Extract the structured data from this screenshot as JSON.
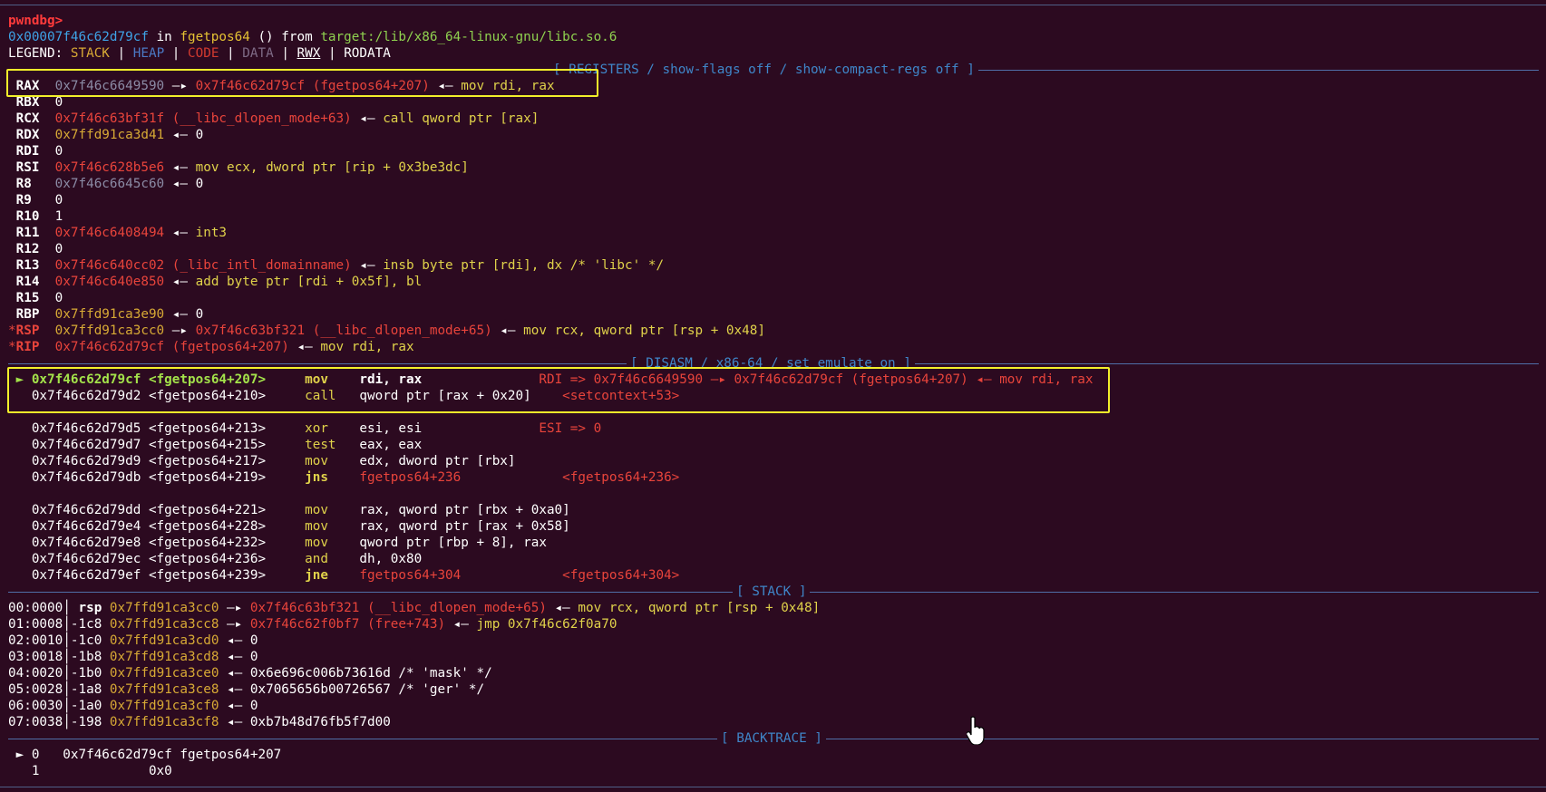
{
  "prompt": "pwndbg>",
  "location": {
    "addr": "0x00007f46c62d79cf",
    "in": " in ",
    "func": "fgetpos64",
    "args": " () from ",
    "lib": "target:/lib/x86_64-linux-gnu/libc.so.6"
  },
  "legend": {
    "label": "LEGEND: ",
    "stack": "STACK",
    "heap": "HEAP",
    "code": "CODE",
    "data": "DATA",
    "rwx": "RWX",
    "rodata": "RODATA",
    "sep": " | "
  },
  "sections": {
    "registers": "[ REGISTERS / show-flags off / show-compact-regs off ]",
    "disasm": "[ DISASM / x86-64 / set emulate on ]",
    "stack": "[ STACK ]",
    "backtrace": "[ BACKTRACE ]"
  },
  "registers": [
    {
      "star": " ",
      "name": "RAX",
      "pad": " ",
      "value": "0x7f46c6649590",
      "arrow1": " —▸ ",
      "target": "0x7f46c62d79cf (fgetpos64+207)",
      "arrow2": " ◂— ",
      "insn": "mov rdi, rax"
    },
    {
      "star": " ",
      "name": "RBX",
      "pad": " ",
      "value": "0"
    },
    {
      "star": " ",
      "name": "RCX",
      "pad": " ",
      "value": "0x7f46c63bf31f (__libc_dlopen_mode+63)",
      "arrow2": " ◂— ",
      "insn": "call qword ptr [rax]"
    },
    {
      "star": " ",
      "name": "RDX",
      "pad": " ",
      "value": "0x7ffd91ca3d41",
      "arrow2": " ◂— ",
      "insn": "0"
    },
    {
      "star": " ",
      "name": "RDI",
      "pad": " ",
      "value": "0"
    },
    {
      "star": " ",
      "name": "RSI",
      "pad": " ",
      "value": "0x7f46c628b5e6",
      "arrow2": " ◂— ",
      "insn": "mov ecx, dword ptr [rip + 0x3be3dc]"
    },
    {
      "star": " ",
      "name": "R8",
      "pad": "  ",
      "value": "0x7f46c6645c60",
      "arrow2": " ◂— ",
      "insn": "0"
    },
    {
      "star": " ",
      "name": "R9",
      "pad": "  ",
      "value": "0"
    },
    {
      "star": " ",
      "name": "R10",
      "pad": " ",
      "value": "1"
    },
    {
      "star": " ",
      "name": "R11",
      "pad": " ",
      "value": "0x7f46c6408494",
      "arrow2": " ◂— ",
      "insn": "int3"
    },
    {
      "star": " ",
      "name": "R12",
      "pad": " ",
      "value": "0"
    },
    {
      "star": " ",
      "name": "R13",
      "pad": " ",
      "value": "0x7f46c640cc02 (_libc_intl_domainname)",
      "arrow2": " ◂— ",
      "insn": "insb byte ptr [rdi], dx /* 'libc' */"
    },
    {
      "star": " ",
      "name": "R14",
      "pad": " ",
      "value": "0x7f46c640e850",
      "arrow2": " ◂— ",
      "insn": "add byte ptr [rdi + 0x5f], bl"
    },
    {
      "star": " ",
      "name": "R15",
      "pad": " ",
      "value": "0"
    },
    {
      "star": " ",
      "name": "RBP",
      "pad": " ",
      "value": "0x7ffd91ca3e90",
      "arrow2": " ◂— ",
      "insn": "0"
    },
    {
      "star": "*",
      "name": "RSP",
      "pad": " ",
      "value": "0x7ffd91ca3cc0",
      "arrow1": " —▸ ",
      "target": "0x7f46c63bf321 (__libc_dlopen_mode+65)",
      "arrow2": " ◂— ",
      "insn": "mov rcx, qword ptr [rsp + 0x48]"
    },
    {
      "star": "*",
      "name": "RIP",
      "pad": " ",
      "value": "0x7f46c62d79cf (fgetpos64+207)",
      "arrow2": " ◂— ",
      "insn": "mov rdi, rax"
    }
  ],
  "disasm": [
    {
      "marker": "► ",
      "addr": "0x7f46c62d79cf",
      "sym": "<fgetpos64+207>",
      "mnem": "mov",
      "ops": "rdi, rax",
      "comment": "RDI => 0x7f46c6649590 —▸ 0x7f46c62d79cf (fgetpos64+207) ◂— mov rdi, rax",
      "current": true
    },
    {
      "marker": "  ",
      "addr": "0x7f46c62d79d2",
      "sym": "<fgetpos64+210>",
      "mnem": "call",
      "ops": "qword ptr [rax + 0x20]",
      "comment": "<setcontext+53>"
    },
    {
      "blank": true
    },
    {
      "marker": "  ",
      "addr": "0x7f46c62d79d5",
      "sym": "<fgetpos64+213>",
      "mnem": "xor",
      "ops": "esi, esi",
      "comment": "ESI => 0"
    },
    {
      "marker": "  ",
      "addr": "0x7f46c62d79d7",
      "sym": "<fgetpos64+215>",
      "mnem": "test",
      "ops": "eax, eax",
      "comment": ""
    },
    {
      "marker": "  ",
      "addr": "0x7f46c62d79d9",
      "sym": "<fgetpos64+217>",
      "mnem": "mov",
      "ops": "edx, dword ptr [rbx]",
      "comment": ""
    },
    {
      "marker": "  ",
      "addr": "0x7f46c62d79db",
      "sym": "<fgetpos64+219>",
      "mnem": "jns",
      "ops": "fgetpos64+236",
      "comment": "<fgetpos64+236>"
    },
    {
      "blank": true
    },
    {
      "marker": "  ",
      "addr": "0x7f46c62d79dd",
      "sym": "<fgetpos64+221>",
      "mnem": "mov",
      "ops": "rax, qword ptr [rbx + 0xa0]",
      "comment": ""
    },
    {
      "marker": "  ",
      "addr": "0x7f46c62d79e4",
      "sym": "<fgetpos64+228>",
      "mnem": "mov",
      "ops": "rax, qword ptr [rax + 0x58]",
      "comment": ""
    },
    {
      "marker": "  ",
      "addr": "0x7f46c62d79e8",
      "sym": "<fgetpos64+232>",
      "mnem": "mov",
      "ops": "qword ptr [rbp + 8], rax",
      "comment": ""
    },
    {
      "marker": "  ",
      "addr": "0x7f46c62d79ec",
      "sym": "<fgetpos64+236>",
      "mnem": "and",
      "ops": "dh, 0x80",
      "comment": ""
    },
    {
      "marker": "  ",
      "addr": "0x7f46c62d79ef",
      "sym": "<fgetpos64+239>",
      "mnem": "jne",
      "ops": "fgetpos64+304",
      "comment": "<fgetpos64+304>"
    }
  ],
  "stack": [
    {
      "idx": "00:0000",
      "off": " rsp",
      "addr": "0x7ffd91ca3cc0",
      "arrow1": " —▸ ",
      "target": "0x7f46c63bf321 (__libc_dlopen_mode+65)",
      "arrow2": " ◂— ",
      "val": "mov rcx, qword ptr [rsp + 0x48]"
    },
    {
      "idx": "01:0008",
      "off": "-1c8",
      "addr": "0x7ffd91ca3cc8",
      "arrow1": " —▸ ",
      "target": "0x7f46c62f0bf7 (free+743)",
      "arrow2": " ◂— ",
      "val": "jmp 0x7f46c62f0a70"
    },
    {
      "idx": "02:0010",
      "off": "-1c0",
      "addr": "0x7ffd91ca3cd0",
      "arrow2": " ◂— ",
      "val": "0"
    },
    {
      "idx": "03:0018",
      "off": "-1b8",
      "addr": "0x7ffd91ca3cd8",
      "arrow2": " ◂— ",
      "val": "0"
    },
    {
      "idx": "04:0020",
      "off": "-1b0",
      "addr": "0x7ffd91ca3ce0",
      "arrow2": " ◂— ",
      "val": "0x6e696c006b73616d /* 'mask' */"
    },
    {
      "idx": "05:0028",
      "off": "-1a8",
      "addr": "0x7ffd91ca3ce8",
      "arrow2": " ◂— ",
      "val": "0x7065656b00726567 /* 'ger' */"
    },
    {
      "idx": "06:0030",
      "off": "-1a0",
      "addr": "0x7ffd91ca3cf0",
      "arrow2": " ◂— ",
      "val": "0"
    },
    {
      "idx": "07:0038",
      "off": "-198",
      "addr": "0x7ffd91ca3cf8",
      "arrow2": " ◂— ",
      "val": "0xb7b48d76fb5f7d00"
    }
  ],
  "backtrace": [
    {
      "marker": "► ",
      "num": "0",
      "addr": "0x7f46c62d79cf",
      "sym": "fgetpos64+207"
    },
    {
      "marker": "  ",
      "num": "1",
      "addr": "0x0",
      "sym": ""
    }
  ]
}
